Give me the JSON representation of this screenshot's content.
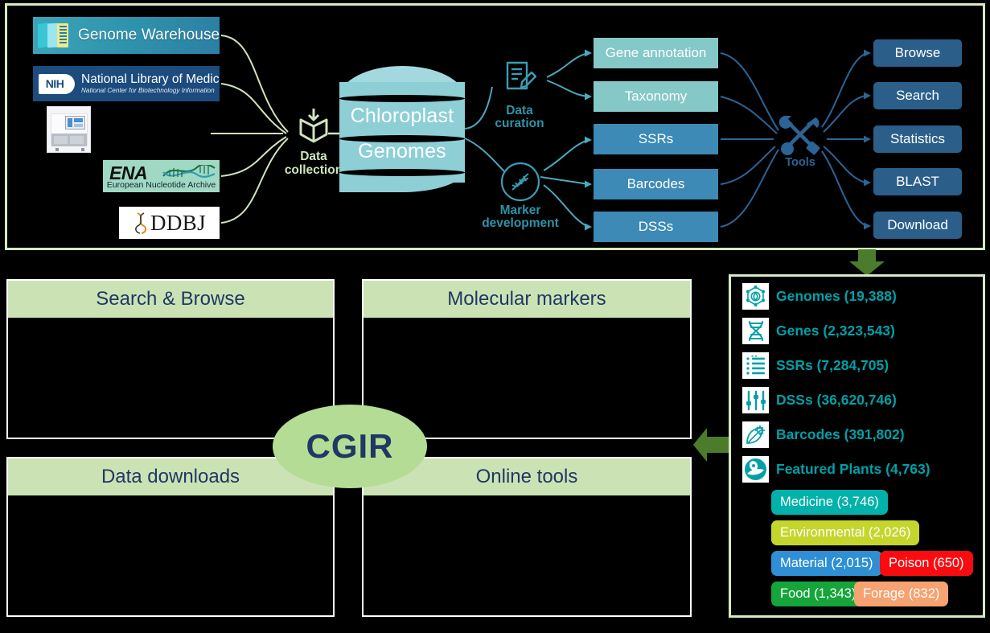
{
  "sources": [
    {
      "name": "Genome Warehouse",
      "icon": "book-stack-icon"
    },
    {
      "name": "National Library of Medicine",
      "subtitle": "National Center for Biotechnology Information",
      "badge": "NIH",
      "icon": "nih-logo-icon"
    },
    {
      "name": "sequencer",
      "icon": "sequencing-machine-icon"
    },
    {
      "name": "ENA",
      "subtitle": "European Nucleotide Archive",
      "icon": "dna-helix-icon"
    },
    {
      "name": "DDBJ",
      "icon": "ddbj-helix-icon"
    }
  ],
  "pipeline": {
    "collection": {
      "label_line1": "Data",
      "label_line2": "collection",
      "icon": "box-download-icon"
    },
    "database": {
      "line1": "Chloroplast",
      "line2": "Genomes"
    },
    "curation": {
      "label_line1": "Data",
      "label_line2": "curation",
      "icon": "document-pencil-icon"
    },
    "marker": {
      "label_line1": "Marker",
      "label_line2": "development",
      "icon": "dna-circle-icon"
    },
    "tools": {
      "label": "Tools",
      "icon": "wrench-hammer-icon"
    }
  },
  "data_types": [
    {
      "label": "Gene annotation",
      "shade": "light"
    },
    {
      "label": "Taxonomy",
      "shade": "light"
    },
    {
      "label": "SSRs",
      "shade": "dark"
    },
    {
      "label": "Barcodes",
      "shade": "dark"
    },
    {
      "label": "DSSs",
      "shade": "dark"
    }
  ],
  "functions": [
    {
      "label": "Browse"
    },
    {
      "label": "Search"
    },
    {
      "label": "Statistics"
    },
    {
      "label": "BLAST"
    },
    {
      "label": "Download"
    }
  ],
  "website": {
    "center_label": "CGIR",
    "quadrants": [
      {
        "title": "Search & Browse"
      },
      {
        "title": "Molecular markers"
      },
      {
        "title": "Data downloads"
      },
      {
        "title": "Online tools"
      }
    ]
  },
  "statistics": {
    "items": [
      {
        "label": "Genomes (19,388)",
        "icon": "genome-network-icon"
      },
      {
        "label": "Genes (2,323,543)",
        "icon": "dna-helix-icon"
      },
      {
        "label": "SSRs (7,284,705)",
        "icon": "list-lines-icon"
      },
      {
        "label": "DSSs (36,620,746)",
        "icon": "sliders-icon"
      },
      {
        "label": "Barcodes (391,802)",
        "icon": "leaf-gear-icon"
      },
      {
        "label": "Featured Plants (4,763)",
        "icon": "plant-circle-icon"
      }
    ],
    "tags": [
      {
        "label": "Medicine (3,746)",
        "color": "#00b2a9"
      },
      {
        "label": "Environmental (2,026)",
        "color": "#c4d62c"
      },
      {
        "label": "Material (2,015)",
        "color": "#2e8fd4"
      },
      {
        "label": "Poison (650)",
        "color": "#fb0b10"
      },
      {
        "label": "Food (1,343)",
        "color": "#15a53a"
      },
      {
        "label": "Forage (832)",
        "color": "#f6a271"
      }
    ]
  },
  "colors": {
    "panel_border": "#d6e9c2",
    "arrow_green": "#4d7b2c",
    "header_green": "#cbe3b4",
    "stat_teal": "#00a0a8",
    "box_dark_blue": "#2b5f8a"
  }
}
